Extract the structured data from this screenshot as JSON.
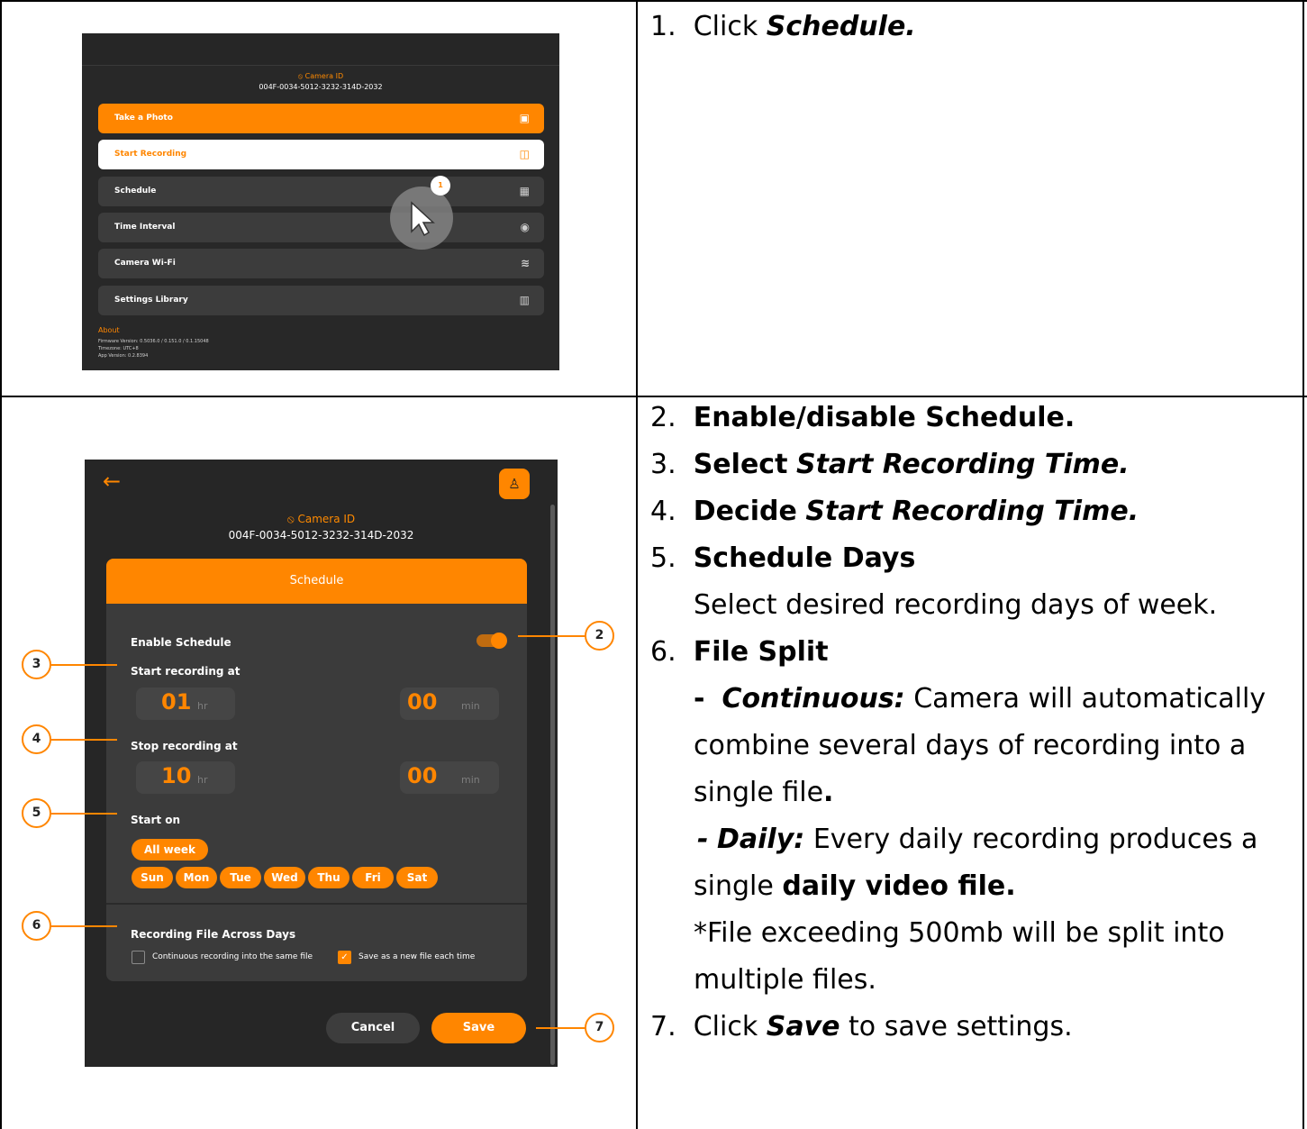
{
  "step1": {
    "number": "1.",
    "pre": "Click",
    "target": "Schedule."
  },
  "app1": {
    "camera_label": "Camera ID",
    "camera_id": "004F-0034-5012-3232-314D-2032",
    "menu": [
      {
        "label": "Take a Photo",
        "icon": "image-icon",
        "glyph": "▣"
      },
      {
        "label": "Start Recording",
        "icon": "video-icon",
        "glyph": "◫"
      },
      {
        "label": "Schedule",
        "icon": "calendar-icon",
        "glyph": "▦"
      },
      {
        "label": "Time Interval",
        "icon": "timer-icon",
        "glyph": "◉"
      },
      {
        "label": "Camera Wi-Fi",
        "icon": "wifi-icon",
        "glyph": "≋"
      },
      {
        "label": "Settings Library",
        "icon": "library-icon",
        "glyph": "▥"
      }
    ],
    "about_title": "About",
    "firmware": "Firmware Version: 0.5036.0 / 0.151.0 / 0.1.15048",
    "timezone": "Timezone: UTC+8",
    "app_version": "App Version: 0.2.8394",
    "cursor_badge": "1"
  },
  "app2": {
    "camera_label": "Camera ID",
    "camera_id": "004F-0034-5012-3232-314D-2032",
    "panel_title": "Schedule",
    "enable_label": "Enable Schedule",
    "start_label": "Start recording at",
    "start_hr": "01",
    "start_min": "00",
    "stop_label": "Stop recording at",
    "stop_hr": "10",
    "stop_min": "00",
    "hr_unit": "hr",
    "min_unit": "min",
    "start_on_label": "Start on",
    "all_week": "All week",
    "days": [
      "Sun",
      "Mon",
      "Tue",
      "Wed",
      "Thu",
      "Fri",
      "Sat"
    ],
    "file_label": "Recording File Across Days",
    "opt_continuous": "Continuous recording into the same file",
    "opt_new": "Save as a new file each time",
    "cancel": "Cancel",
    "save": "Save",
    "toggle_on": true
  },
  "callouts": [
    "2",
    "3",
    "4",
    "5",
    "6",
    "7"
  ],
  "steps": {
    "s2_num": "2.",
    "s2": "Enable/disable Schedule.",
    "s3_num": "3.",
    "s3_pre": "Select",
    "s3_it": "Start Recording Time.",
    "s4_num": "4.",
    "s4_pre": "Decide",
    "s4_it": "Start Recording Time.",
    "s5_num": "5.",
    "s5": "Schedule Days",
    "s5_desc": "Select desired recording days of week.",
    "s6_num": "6.",
    "s6": "File Split",
    "s6_a_dash": "-",
    "s6_a_term": "Continuous:",
    "s6_a_text1": "Camera will automatically",
    "s6_a_text2": "combine several days of recording into a",
    "s6_a_text3": "single file",
    "s6_a_dot": ".",
    "s6_b_dash": "-",
    "s6_b_term": "Daily:",
    "s6_b_text1": "Every daily recording produces a",
    "s6_b_text2": "single",
    "s6_b_bold": "daily video file.",
    "s6_note1": "*File exceeding 500mb will be split into",
    "s6_note2": "multiple files.",
    "s7_num": "7.",
    "s7_pre": "Click",
    "s7_it": "Save",
    "s7_post": "to save settings."
  },
  "colors": {
    "accent": "#ff8600",
    "app_bg": "#262626",
    "panel": "#3b3b3b"
  }
}
